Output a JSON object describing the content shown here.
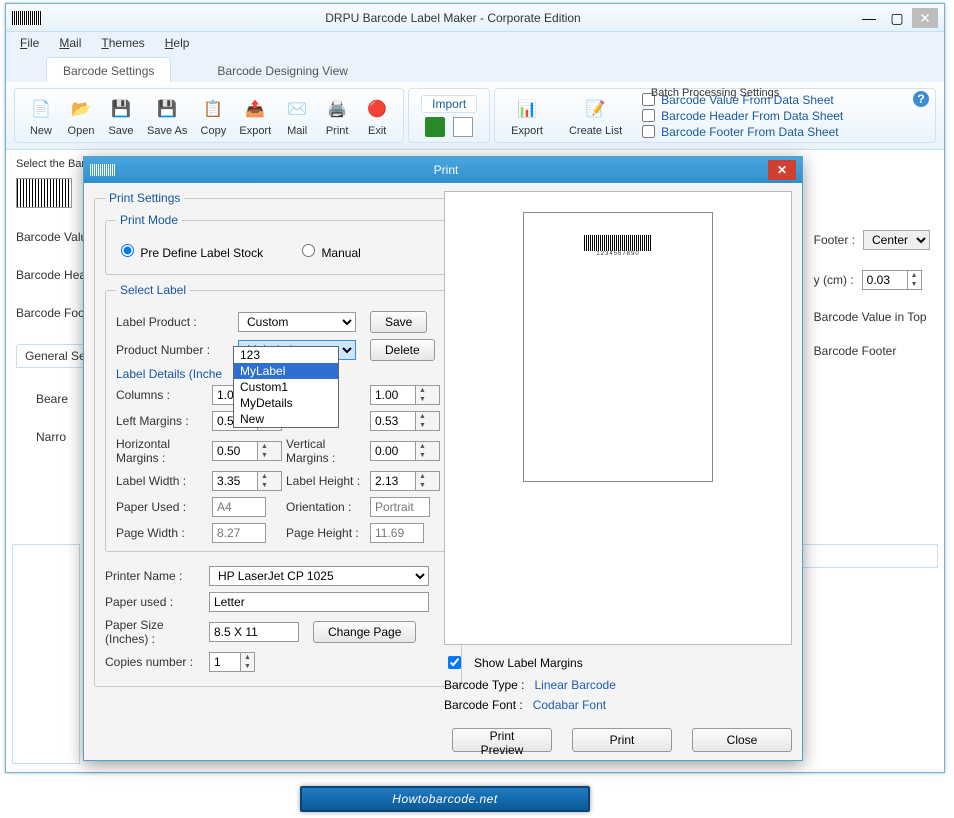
{
  "window": {
    "title": "DRPU Barcode Label Maker - Corporate Edition"
  },
  "menu": {
    "file": "File",
    "mail": "Mail",
    "themes": "Themes",
    "help": "Help"
  },
  "tabs": {
    "settings": "Barcode Settings",
    "design": "Barcode Designing View"
  },
  "ribbon": {
    "new": "New",
    "open": "Open",
    "save": "Save",
    "saveas": "Save As",
    "copy": "Copy",
    "export": "Export",
    "mail": "Mail",
    "print": "Print",
    "exit": "Exit",
    "import": "Import",
    "export2": "Export",
    "createlist": "Create List",
    "batch_title": "Batch Processing Settings",
    "bv": "Barcode Value From Data Sheet",
    "bh": "Barcode Header From Data Sheet",
    "bf": "Barcode Footer From Data Sheet"
  },
  "bg": {
    "select": "Select the Bar",
    "bv": "Barcode Valu",
    "bh": "Barcode Hea",
    "bfoot": "Barcode Foo",
    "gs": "General Setti",
    "beare": "Beare",
    "narrow": "Narro",
    "footer": "Footer :",
    "footer_val": "Center",
    "ycm": "y (cm) :",
    "ycm_val": "0.03",
    "bvtop": "Barcode Value in Top",
    "bfooter": "Barcode Footer"
  },
  "dialog": {
    "title": "Print",
    "ps": "Print Settings",
    "pm": "Print Mode",
    "predef": "Pre Define Label Stock",
    "manual": "Manual",
    "sl": "Select Label",
    "lp": "Label Product :",
    "lp_val": "Custom",
    "save": "Save",
    "pn": "Product Number :",
    "pn_val": "MyLabel",
    "delete": "Delete",
    "ld": "Label Details (Inche",
    "cols": "Columns :",
    "cols_val": "1.00",
    "rows_val": "1.00",
    "lm": "Left Margins :",
    "lm_val": "0.59",
    "tm_val": "0.53",
    "hm": "Horizontal Margins :",
    "hm_val": "0.50",
    "vm": "Vertical Margins :",
    "vm_val": "0.00",
    "lw": "Label Width :",
    "lw_val": "3.35",
    "lh": "Label Height :",
    "lh_val": "2.13",
    "pu": "Paper Used :",
    "pu_val": "A4",
    "or": "Orientation :",
    "or_val": "Portrait",
    "pw": "Page Width :",
    "pw_val": "8.27",
    "ph": "Page Height :",
    "ph_val": "11.69",
    "printer": "Printer Name :",
    "printer_val": "HP LaserJet CP 1025",
    "paper": "Paper used :",
    "paper_val": "Letter",
    "psize": "Paper Size (Inches) :",
    "psize_val": "8.5 X 11",
    "change": "Change Page",
    "copies": "Copies number :",
    "copies_val": "1",
    "showmargins": "Show Label Margins",
    "btype": "Barcode Type :",
    "btype_val": "Linear Barcode",
    "bfont": "Barcode Font :",
    "bfont_val": "Codabar Font",
    "preview": "Print Preview",
    "printbtn": "Print",
    "close": "Close",
    "dd": {
      "o1": "123",
      "o2": "MyLabel",
      "o3": "Custom1",
      "o4": "MyDetails",
      "o5": "New"
    },
    "mini": "1234567890"
  },
  "watermark": "Howtobarcode.net"
}
